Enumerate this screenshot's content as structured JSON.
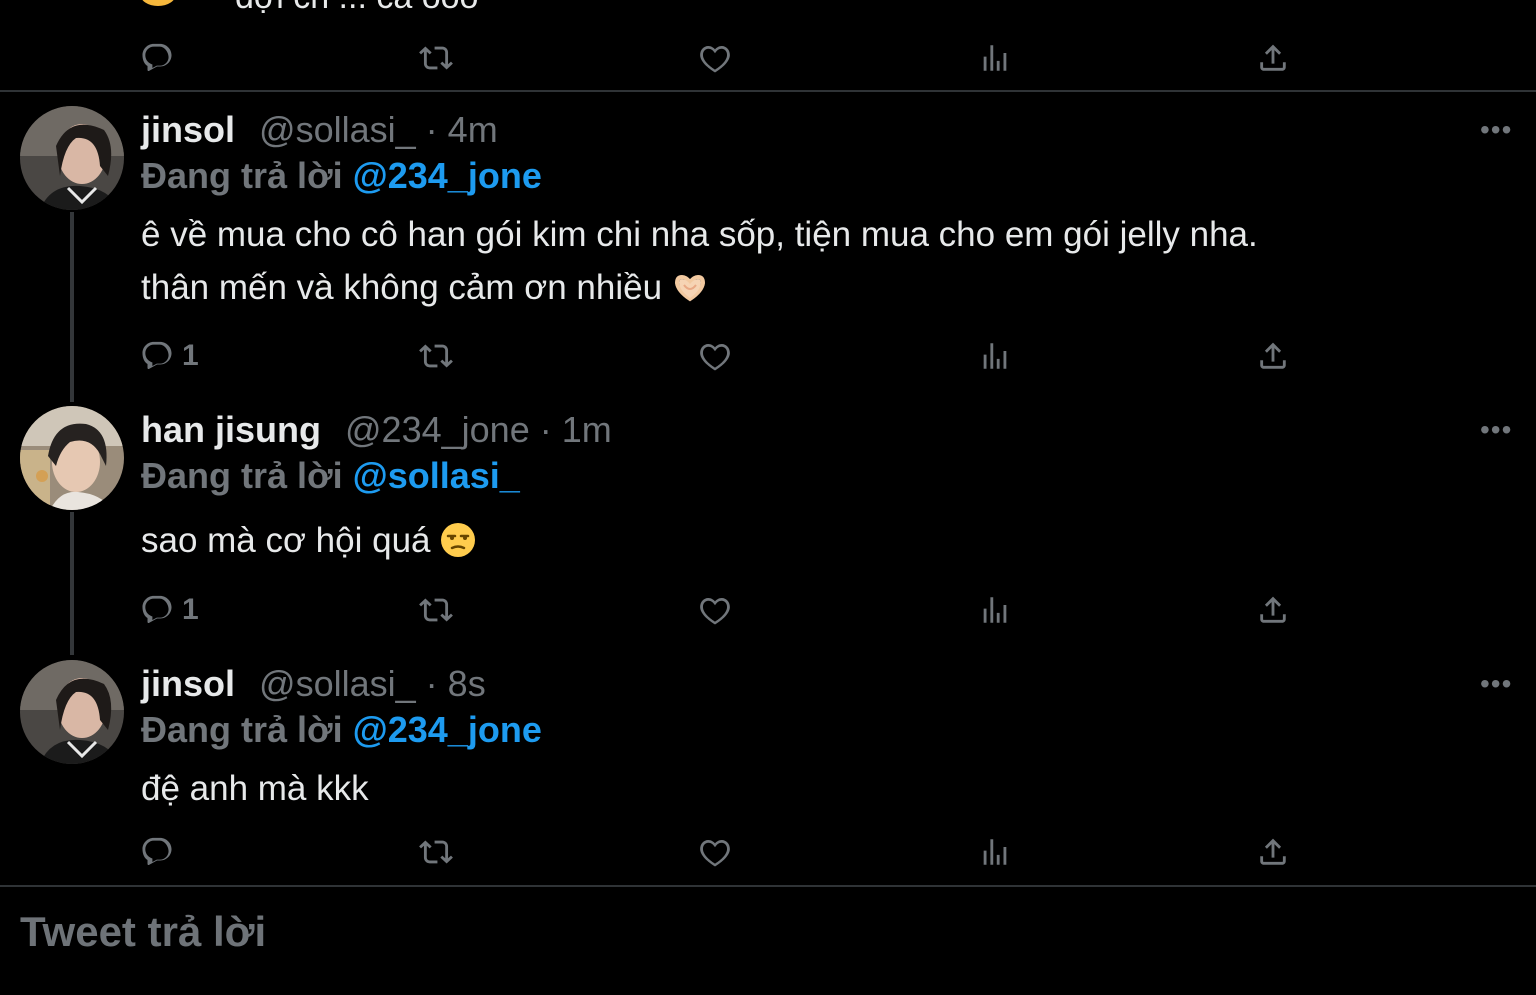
{
  "top_tweet": {
    "partial_text": "đợi ch ... cá oóo"
  },
  "tweets": [
    {
      "name": "jinsol",
      "handle": "@sollasi_",
      "separator": "·",
      "time": "4m",
      "reply_prefix": "Đang trả lời",
      "reply_to": "@234_jone",
      "body_line1": "ê về mua cho cô han gói kim chi nha sốp, tiện mua cho em gói jelly nha.",
      "body_line2": "thân mến và không cảm ơn nhiều",
      "emoji": "heart-hands-emoji",
      "reply_count": "1"
    },
    {
      "name": "han jisung",
      "handle": "@234_jone",
      "separator": "·",
      "time": "1m",
      "reply_prefix": "Đang trả lời",
      "reply_to": "@sollasi_",
      "body_line1": "sao mà cơ hội quá",
      "emoji": "unamused-face-emoji",
      "reply_count": "1"
    },
    {
      "name": "jinsol",
      "handle": "@sollasi_",
      "separator": "·",
      "time": "8s",
      "reply_prefix": "Đang trả lời",
      "reply_to": "@234_jone",
      "body_line1": "đệ anh mà kkk"
    }
  ],
  "more_label": "•••",
  "reply_box": {
    "placeholder": "Tweet trả lời"
  },
  "colors": {
    "background": "#000000",
    "text": "#e7e9ea",
    "muted": "#71767b",
    "link": "#1d9bf0",
    "divider": "#2f3336"
  }
}
